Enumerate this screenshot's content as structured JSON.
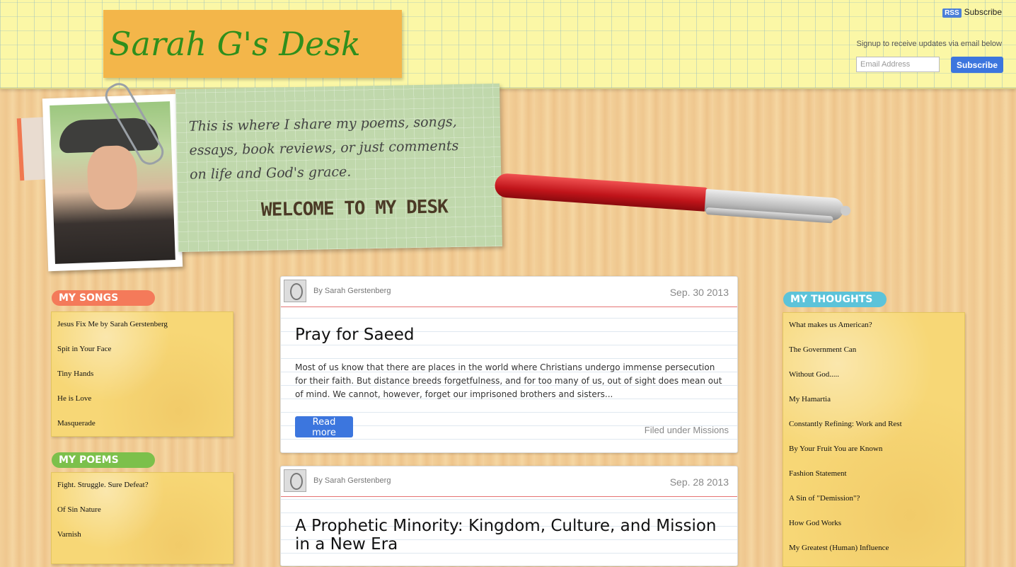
{
  "header": {
    "site_title": "Sarah G's Desk",
    "rss_badge": "RSS",
    "rss_label": "Subscribe",
    "signup_text": "Signup to receive updates via email below",
    "email_placeholder": "Email Address",
    "subscribe_button": "Subscribe"
  },
  "banner": {
    "tagline": "This is where I share my poems, songs, essays, book reviews, or just comments on life and God's grace.",
    "welcome": "WELCOME TO MY DESK"
  },
  "sidebar_left": {
    "songs": {
      "title": "MY SONGS",
      "items": [
        "Jesus Fix Me by Sarah Gerstenberg",
        "Spit in Your Face",
        "Tiny Hands",
        "He is Love",
        "Masquerade"
      ]
    },
    "poems": {
      "title": "MY POEMS",
      "items": [
        "Fight. Struggle. Sure Defeat?",
        "Of Sin Nature",
        "Varnish"
      ]
    }
  },
  "sidebar_right": {
    "thoughts": {
      "title": "MY THOUGHTS",
      "items": [
        "What makes us American?",
        "The Government Can",
        "Without God.....",
        "My Hamartia",
        "Constantly Refining: Work and Rest",
        "By Your Fruit You are Known",
        "Fashion Statement",
        "A Sin of \"Demission\"?",
        "How God Works",
        "My Greatest (Human) Influence"
      ]
    }
  },
  "posts": [
    {
      "author": "By Sarah Gerstenberg",
      "date": "Sep. 30 2013",
      "title": "Pray for Saeed",
      "excerpt": "Most of us know that there are places in the world where Christians undergo immense persecution for their faith. But distance breeds forgetfulness, and for too many of us, out of sight does mean out of mind. We cannot, however, forget our imprisoned brothers and sisters...",
      "read_more": "Read more",
      "category": "Filed under Missions"
    },
    {
      "author": "By Sarah Gerstenberg",
      "date": "Sep. 28 2013",
      "title": "A Prophetic Minority: Kingdom, Culture, and Mission in a New Era"
    }
  ],
  "colors": {
    "songs_tab": "#f47a5a",
    "poems_tab": "#7cc04b",
    "thoughts_tab": "#5cc3d9",
    "accent_button": "#3c76de",
    "title_green": "#2f8f1c"
  }
}
